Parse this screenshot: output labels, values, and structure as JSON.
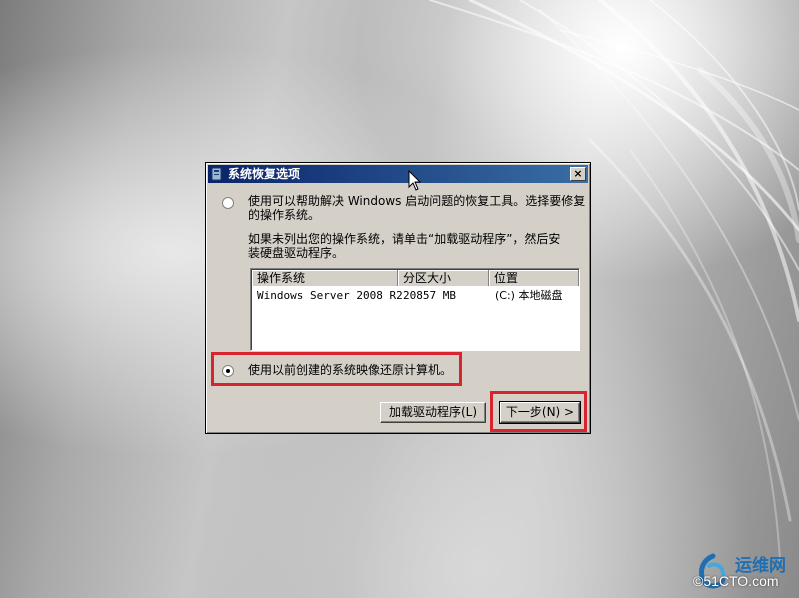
{
  "dialog": {
    "title": "系统恢复选项",
    "close_label": "×",
    "option1": {
      "text": "使用可以帮助解决 Windows 启动问题的恢复工具。选择要修复的操作系统。",
      "line1": "使用可以帮助解决 Windows 启动问题的恢复工具。选择要修复",
      "line2": "的操作系统。",
      "selected": false
    },
    "hint": {
      "line1": "如果未列出您的操作系统，请单击“加载驱动程序”，然后安",
      "line2": "装硬盘驱动程序。"
    },
    "table": {
      "columns": [
        "操作系统",
        "分区大小",
        "位置"
      ],
      "rows": [
        {
          "os": "Windows Server 2008 R2",
          "size": "20857 MB",
          "location": "(C:) 本地磁盘"
        }
      ]
    },
    "option2": {
      "text": "使用以前创建的系统映像还原计算机。",
      "selected": true
    },
    "buttons": {
      "load_driver": "加载驱动程序(L)",
      "next": "下一步(N) >"
    }
  },
  "watermark": {
    "brand_cn": "运维网",
    "url": "©51CTO.com"
  },
  "colors": {
    "titlebar_start": "#0a246a",
    "titlebar_end": "#3a6ea5",
    "dialog_bg": "#d4d0c8",
    "highlight_red": "#d9242f"
  }
}
